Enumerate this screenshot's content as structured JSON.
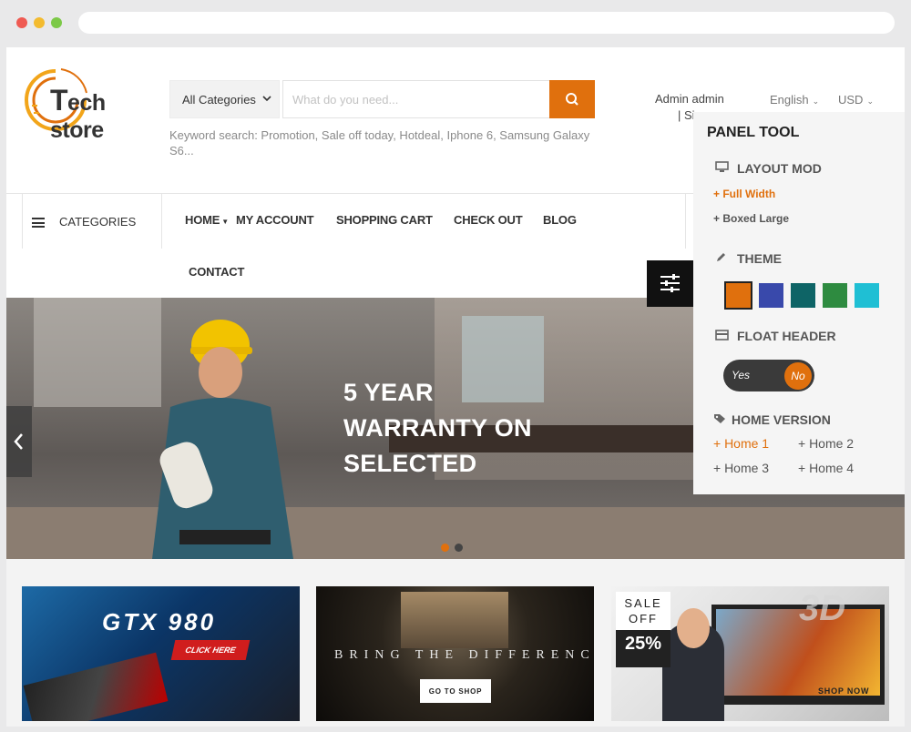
{
  "brand": {
    "logo_text_big": "T",
    "logo_text_rest": "ech store",
    "accent": "#e0700d"
  },
  "search": {
    "category_label": "All Categories",
    "placeholder": "What do you need...",
    "keywords": "Keyword search: Promotion, Sale off today, Hotdeal, Iphone 6, Samsung Galaxy S6..."
  },
  "header": {
    "account": "Admin admin",
    "account_line2": "| Si",
    "language": "English",
    "currency": "USD"
  },
  "nav": {
    "categories": "CATEGORIES",
    "items": [
      "HOME",
      "MY ACCOUNT",
      "SHOPPING CART",
      "CHECK OUT",
      "BLOG",
      "CONTACT"
    ]
  },
  "panel": {
    "title": "PANEL TOOL",
    "layout_mod": "LAYOUT MOD",
    "full_width": "+ Full Width",
    "boxed_large": "+ Boxed Large",
    "theme": "THEME",
    "theme_colors": [
      "#e0700d",
      "#3949ab",
      "#0e6466",
      "#2e8b40",
      "#1fbfd4"
    ],
    "float_header": "FLOAT HEADER",
    "toggle_yes": "Yes",
    "toggle_no": "No",
    "home_version": "HOME VERSION",
    "homes": [
      "+ Home 1",
      "+ Home 2",
      "+ Home 3",
      "+ Home 4"
    ]
  },
  "hero": {
    "line1": "5 YEAR",
    "line2": "WARRANTY ON",
    "line3": "SELECTED"
  },
  "banners": {
    "b1_title": "GTX 980",
    "b1_cta": "CLICK HERE",
    "b2_title": "BRING THE DIFFERENCE",
    "b2_cta": "GO TO SHOP",
    "b3_sale": "SALE",
    "b3_off": "OFF",
    "b3_pct": "25%",
    "b3_3d": "3D",
    "b3_cta": "SHOP NOW"
  }
}
